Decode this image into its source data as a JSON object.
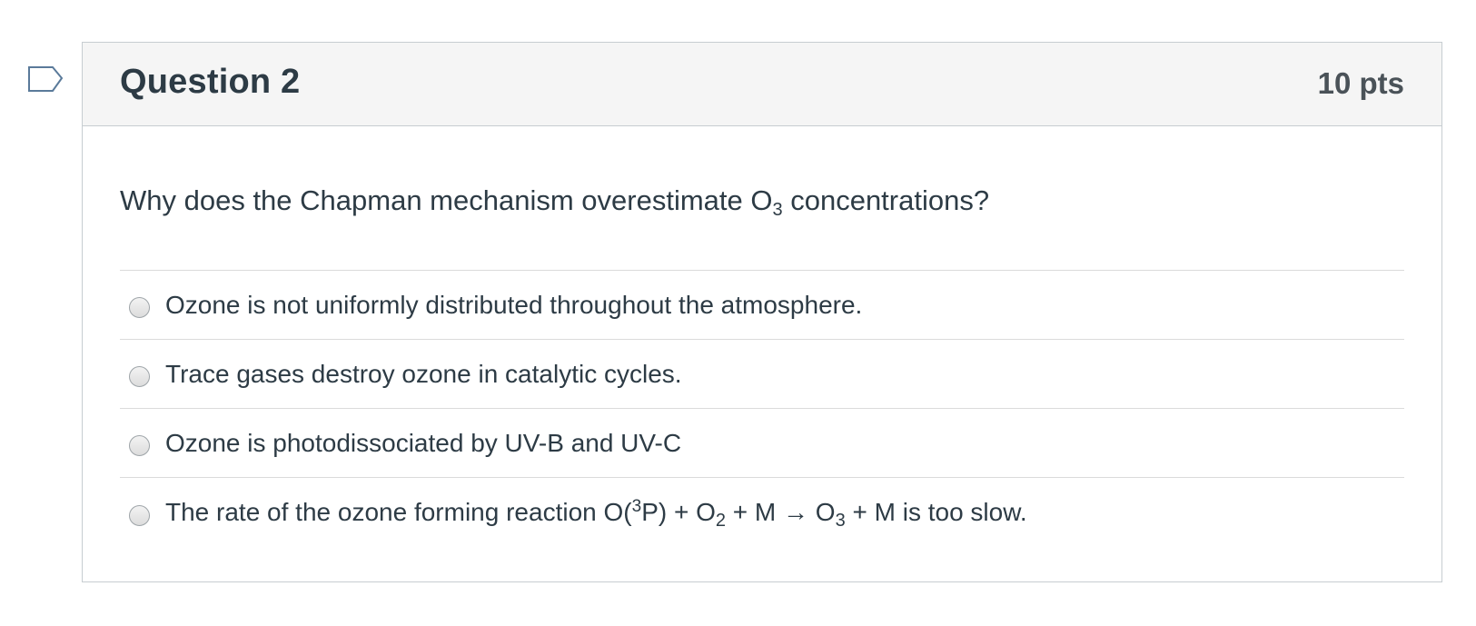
{
  "question": {
    "title": "Question 2",
    "points": "10 pts",
    "flag_icon": "bookmark-flag-icon",
    "prompt": {
      "before": "Why does the Chapman mechanism overestimate O",
      "sub": "3",
      "after": " concentrations?"
    }
  },
  "answers": [
    {
      "label": "Ozone is not uniformly distributed throughout the atmosphere."
    },
    {
      "label": "Trace gases destroy ozone in catalytic cycles."
    },
    {
      "label": "Ozone is photodissociated by UV-B and UV-C"
    },
    {
      "part1": "The rate of the ozone forming reaction O(",
      "sup1": "3",
      "part2": "P) + O",
      "sub1": "2",
      "part3": " + M → O",
      "sub2": "3",
      "part4": " + M is too slow."
    }
  ],
  "colors": {
    "header_bg": "#f5f5f5",
    "border": "#c7cdd1",
    "text": "#2d3b45",
    "flag": "#5a7a9a"
  }
}
